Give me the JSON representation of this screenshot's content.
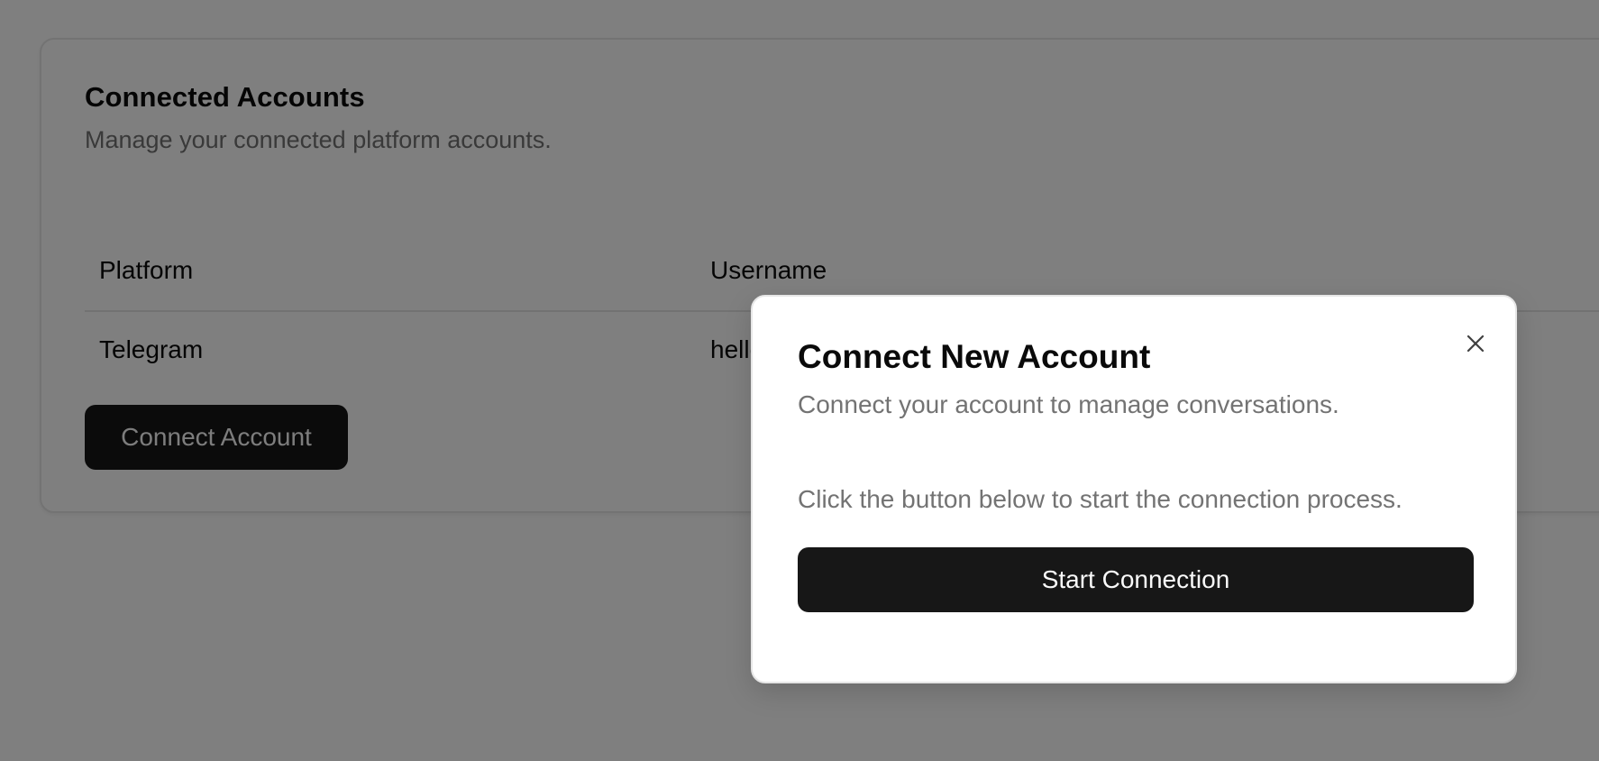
{
  "card": {
    "title": "Connected Accounts",
    "description": "Manage your connected platform accounts.",
    "table": {
      "headers": [
        "Platform",
        "Username"
      ],
      "rows": [
        {
          "platform": "Telegram",
          "username": "hello"
        }
      ]
    },
    "connect_button_label": "Connect Account"
  },
  "dialog": {
    "title": "Connect New Account",
    "description": "Connect your account to manage conversations.",
    "body": "Click the button below to start the connection process.",
    "start_button_label": "Start Connection",
    "close_icon": "close-icon"
  },
  "colors": {
    "primary_button": "#171717",
    "primary_button_text": "#fafafa",
    "muted_text": "#737373",
    "overlay": "rgba(0,0,0,0.5)"
  }
}
